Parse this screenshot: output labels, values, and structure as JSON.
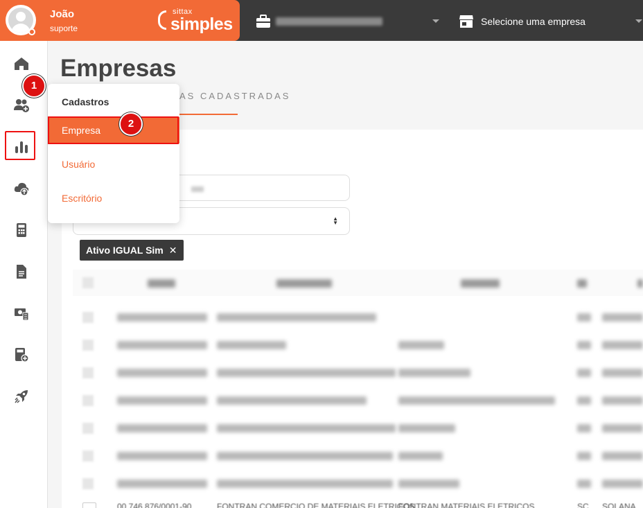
{
  "header": {
    "user_name": "João",
    "user_role": "suporte",
    "logo_small": "sittax",
    "logo_big": "simples",
    "company_select": "Selecione uma empresa"
  },
  "sidebar": {
    "icons": [
      "home-icon",
      "users-add-icon",
      "chart-bars-icon",
      "cloud-upload-icon",
      "calculator-icon",
      "document-icon",
      "money-icon",
      "calc-add-icon",
      "rocket-icon"
    ]
  },
  "annotations": {
    "step1": "1",
    "step2": "2"
  },
  "page": {
    "title": "Empresas",
    "tab": "AS CADASTRADAS"
  },
  "filter": {
    "chip_label": "Ativo IGUAL Sim",
    "chip_close": "✕"
  },
  "menu": {
    "header": "Cadastros",
    "items": [
      "Empresa",
      "Usuário",
      "Escritório"
    ]
  },
  "table": {
    "last_row": {
      "col1": "00.746.876/0001-90",
      "col2": "FONTRAN COMERCIO DE MATERIAIS ELETRICOS",
      "col3": "FONTRAN MATERIAIS ELETRICOS",
      "col4": "SC",
      "col5": "SOLANA"
    }
  },
  "colors": {
    "accent": "#f26a36",
    "topbar": "#3a3a3a",
    "annotation": "#dd1111"
  }
}
